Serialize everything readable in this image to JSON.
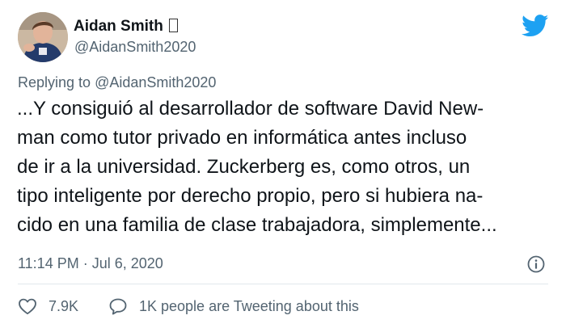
{
  "author": {
    "name": "Aidan Smith",
    "handle": "@AidanSmith2020"
  },
  "brand": {
    "icon": "twitter-bird-icon",
    "color": "#1da1f2"
  },
  "reply": {
    "prefix": "Replying to ",
    "target": "@AidanSmith2020"
  },
  "tweet": {
    "lines": [
      "...Y consiguió al desarrollador de software David New-",
      "man como tutor privado en informática antes incluso",
      "de ir a la universidad. Zuckerberg es, como otros, un",
      "tipo inteligente por derecho propio, pero si hubiera na-",
      "cido en una familia de clase trabajadora, simplemente..."
    ],
    "timestamp": "11:14 PM · Jul 6, 2020",
    "info_icon": "info-icon"
  },
  "stats": {
    "likes": "7.9K",
    "like_icon": "heart-icon",
    "reply_icon": "speech-bubble-icon",
    "conversation": "1K people are Tweeting about this"
  },
  "colors": {
    "text": "#0f1419",
    "muted": "#536471",
    "divider": "#e1e8ed"
  }
}
